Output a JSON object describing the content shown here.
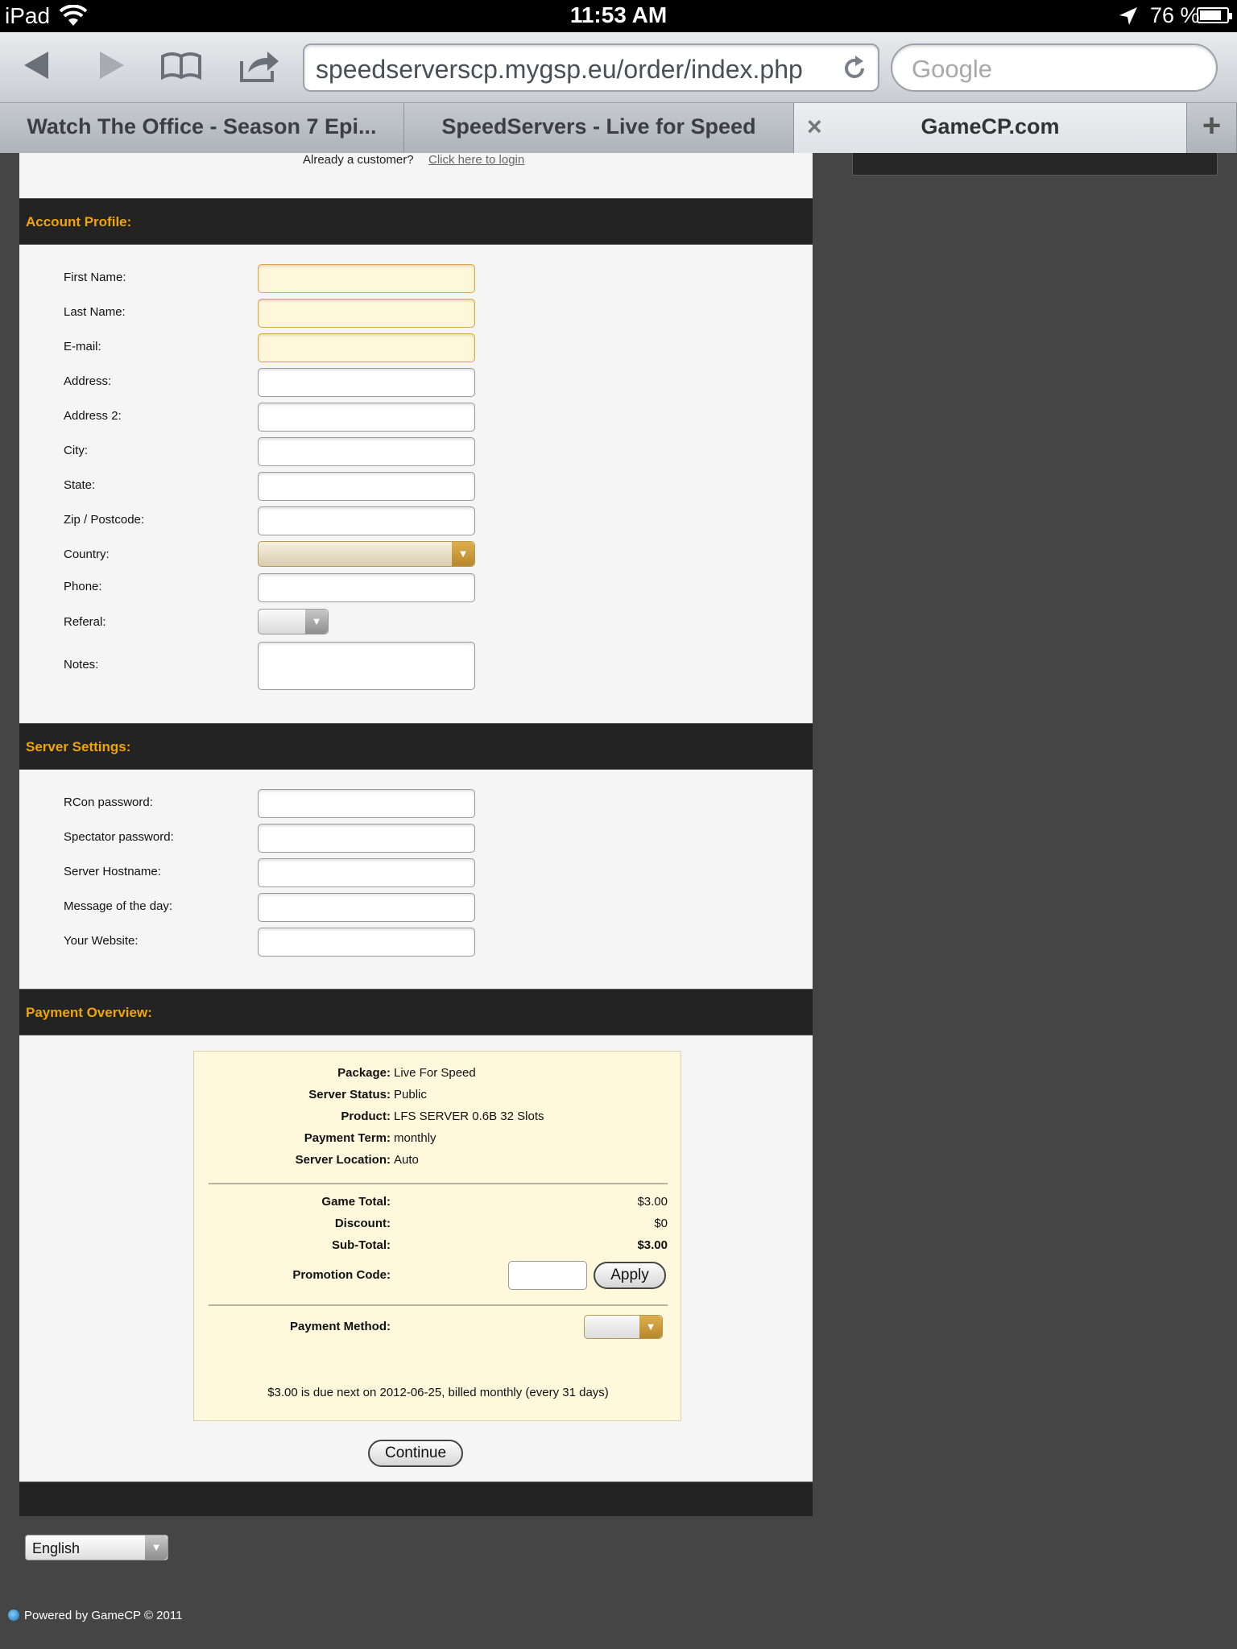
{
  "status_bar": {
    "device": "iPad",
    "time": "11:53 AM",
    "battery": "76 %"
  },
  "browser": {
    "url": "speedserverscp.mygsp.eu/order/index.php",
    "search_placeholder": "Google",
    "tabs": [
      {
        "label": "Watch The Office - Season 7 Epi..."
      },
      {
        "label": "SpeedServers - Live for Speed"
      },
      {
        "label": "GameCP.com",
        "close": "×"
      }
    ],
    "new_tab": "+"
  },
  "page": {
    "login_prompt": "Already a customer?",
    "login_link": "Click here to login",
    "account_profile": {
      "heading": "Account Profile:",
      "fields": {
        "first_name": "First Name:",
        "last_name": "Last Name:",
        "email": "E-mail:",
        "address": "Address:",
        "address2": "Address 2:",
        "city": "City:",
        "state": "State:",
        "zip": "Zip / Postcode:",
        "country": "Country:",
        "phone": "Phone:",
        "referal": "Referal:",
        "notes": "Notes:"
      }
    },
    "server_settings": {
      "heading": "Server Settings:",
      "fields": {
        "rcon": "RCon password:",
        "spectator": "Spectator password:",
        "hostname": "Server Hostname:",
        "motd": "Message of the day:",
        "website": "Your Website:"
      }
    },
    "payment": {
      "heading": "Payment Overview:",
      "package_label": "Package:",
      "package": "Live For Speed",
      "status_label": "Server Status:",
      "status": "Public",
      "product_label": "Product:",
      "product": "LFS SERVER 0.6B 32 Slots",
      "term_label": "Payment Term:",
      "term": "monthly",
      "location_label": "Server Location:",
      "location": "Auto",
      "game_total_label": "Game Total:",
      "game_total": "$3.00",
      "discount_label": "Discount:",
      "discount": "$0",
      "subtotal_label": "Sub-Total:",
      "subtotal": "$3.00",
      "promo_label": "Promotion Code:",
      "apply": "Apply",
      "method_label": "Payment Method:",
      "due_note": "$3.00 is due next on 2012-06-25, billed monthly (every 31 days)"
    },
    "continue": "Continue",
    "language": "English",
    "footer": "Powered by GameCP © 2011"
  }
}
